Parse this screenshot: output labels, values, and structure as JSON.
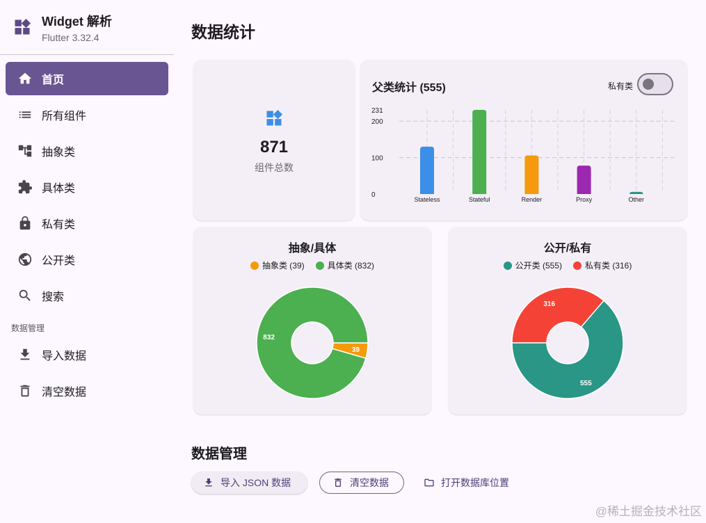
{
  "brand": {
    "title": "Widget 解析",
    "subtitle": "Flutter 3.32.4"
  },
  "nav": {
    "items": [
      {
        "label": "首页",
        "icon": "home-icon",
        "active": true
      },
      {
        "label": "所有组件",
        "icon": "list-icon"
      },
      {
        "label": "抽象类",
        "icon": "tree-icon"
      },
      {
        "label": "具体类",
        "icon": "puzzle-icon"
      },
      {
        "label": "私有类",
        "icon": "lock-icon"
      },
      {
        "label": "公开类",
        "icon": "globe-icon"
      },
      {
        "label": "搜索",
        "icon": "search-icon"
      }
    ],
    "section_label": "数据管理",
    "data_items": [
      {
        "label": "导入数据",
        "icon": "download-icon"
      },
      {
        "label": "清空数据",
        "icon": "trash-icon"
      }
    ]
  },
  "page": {
    "title": "数据统计"
  },
  "total": {
    "number": "871",
    "label": "组件总数"
  },
  "bars_card": {
    "title": "父类统计 (555)",
    "toggle_label": "私有类",
    "toggle_on": false
  },
  "abs_card": {
    "title": "抽象/具体",
    "legend": [
      {
        "label": "抽象类 (39)",
        "color": "#f59a0c"
      },
      {
        "label": "具体类 (832)",
        "color": "#4caf50"
      }
    ]
  },
  "pub_card": {
    "title": "公开/私有",
    "legend": [
      {
        "label": "公开类 (555)",
        "color": "#2a9686"
      },
      {
        "label": "私有类 (316)",
        "color": "#f44336"
      }
    ]
  },
  "chart_data": [
    {
      "type": "bar",
      "title": "父类统计 (555)",
      "categories": [
        "Stateless",
        "Stateful",
        "Render",
        "Proxy",
        "Other"
      ],
      "values": [
        130,
        231,
        106,
        78,
        6
      ],
      "colors": [
        "#3b8fe8",
        "#4caf50",
        "#f59a0c",
        "#9c27b0",
        "#2a9686"
      ],
      "ylim": [
        0,
        231
      ],
      "yticks": [
        "0",
        "100",
        "200",
        "231"
      ],
      "grid": true
    },
    {
      "type": "pie",
      "title": "抽象/具体",
      "slices": [
        {
          "label": "39",
          "value": 39,
          "color": "#f59a0c"
        },
        {
          "label": "832",
          "value": 832,
          "color": "#4caf50"
        }
      ]
    },
    {
      "type": "pie",
      "title": "公开/私有",
      "slices": [
        {
          "label": "316",
          "value": 316,
          "color": "#f44336"
        },
        {
          "label": "555",
          "value": 555,
          "color": "#2a9686"
        }
      ]
    }
  ],
  "data_section": {
    "title": "数据管理",
    "import_label": "导入 JSON 数据",
    "clear_label": "清空数据",
    "open_label": "打开数据库位置"
  },
  "watermark": "@稀土掘金技术社区"
}
